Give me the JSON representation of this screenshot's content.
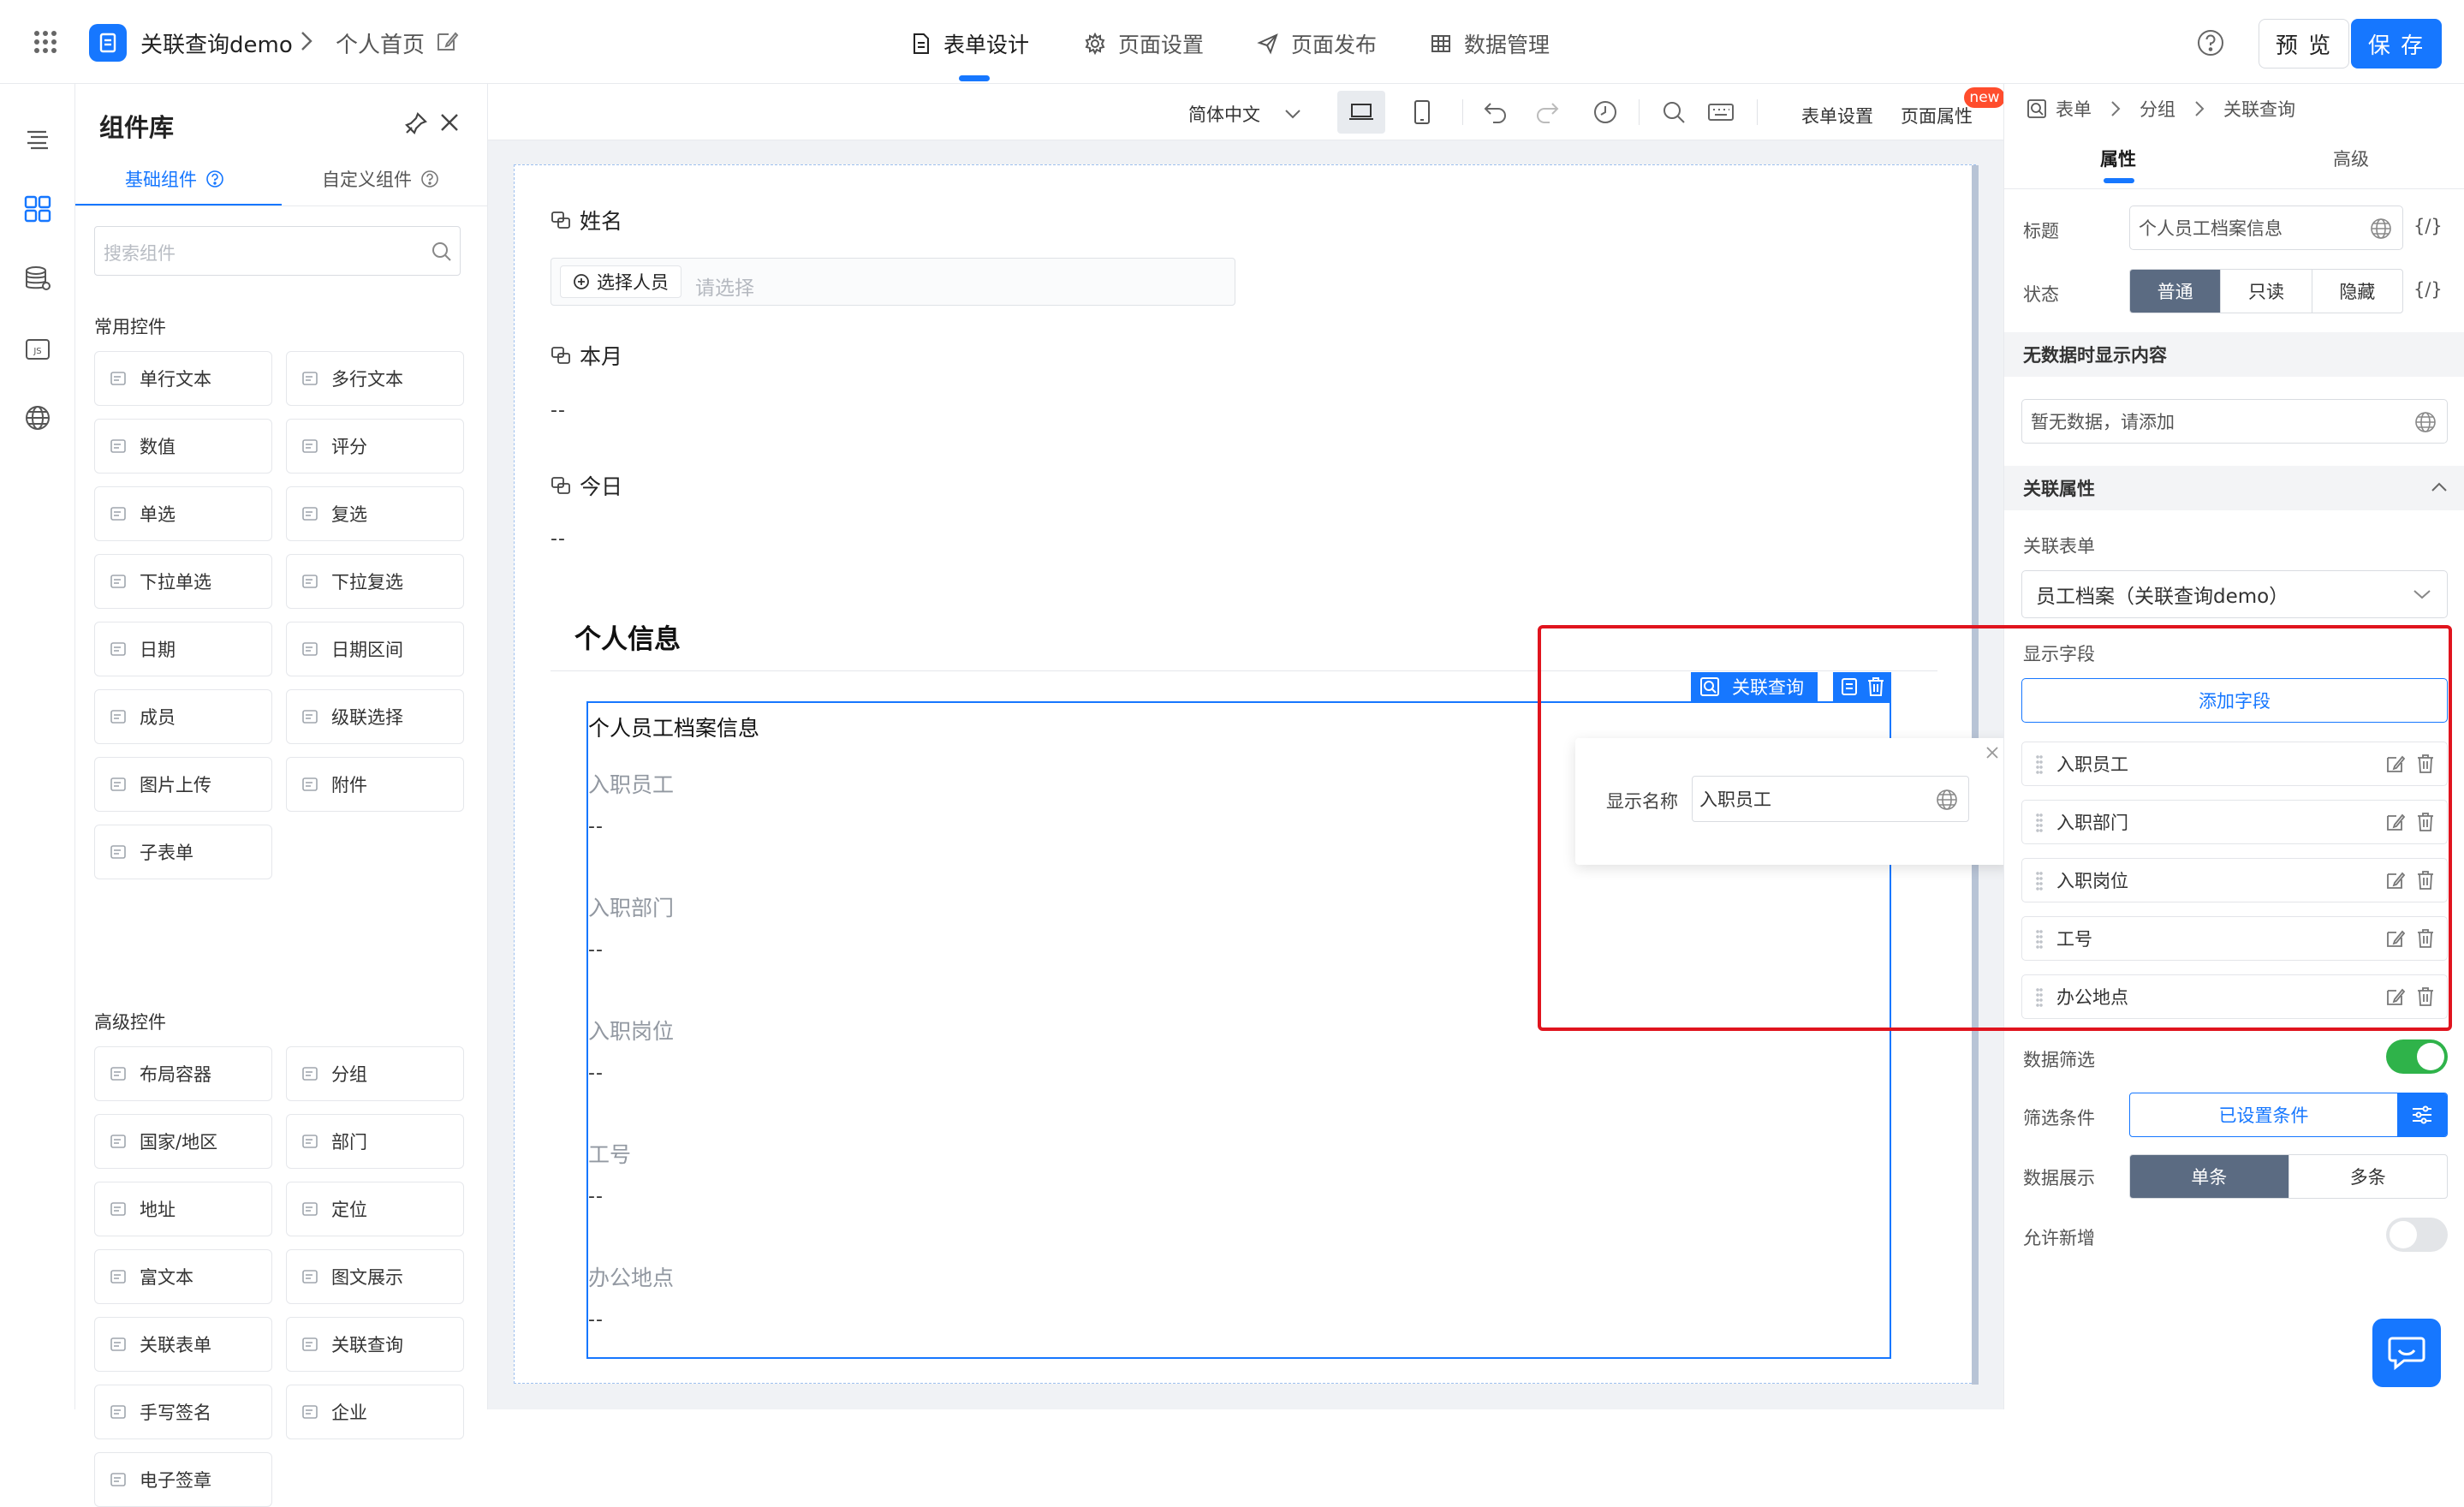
{
  "header": {
    "app_title": "关联查询demo",
    "breadcrumb_page": "个人首页",
    "tabs": [
      {
        "label": "表单设计",
        "icon": "form-icon",
        "active": true
      },
      {
        "label": "页面设置",
        "icon": "gear-icon",
        "active": false
      },
      {
        "label": "页面发布",
        "icon": "send-icon",
        "active": false
      },
      {
        "label": "数据管理",
        "icon": "table-icon",
        "active": false
      }
    ],
    "preview_label": "预 览",
    "save_label": "保 存",
    "accent_color": "#1677ff"
  },
  "rail": {
    "icons": [
      "outline-icon",
      "components-icon",
      "datasource-icon",
      "js-icon",
      "globe-icon"
    ]
  },
  "library": {
    "title": "组件库",
    "tabs": [
      "基础组件",
      "自定义组件"
    ],
    "search_placeholder": "搜索组件",
    "common_title": "常用控件",
    "common": [
      {
        "label": "单行文本",
        "icon": "single-line-icon"
      },
      {
        "label": "多行文本",
        "icon": "multi-line-icon"
      },
      {
        "label": "数值",
        "icon": "number-icon"
      },
      {
        "label": "评分",
        "icon": "star-icon"
      },
      {
        "label": "单选",
        "icon": "radio-icon"
      },
      {
        "label": "复选",
        "icon": "checkbox-icon"
      },
      {
        "label": "下拉单选",
        "icon": "dropdown-icon"
      },
      {
        "label": "下拉复选",
        "icon": "multi-dropdown-icon"
      },
      {
        "label": "日期",
        "icon": "calendar-icon"
      },
      {
        "label": "日期区间",
        "icon": "date-range-icon"
      },
      {
        "label": "成员",
        "icon": "user-icon"
      },
      {
        "label": "级联选择",
        "icon": "cascade-icon"
      },
      {
        "label": "图片上传",
        "icon": "image-icon"
      },
      {
        "label": "附件",
        "icon": "paperclip-icon"
      },
      {
        "label": "子表单",
        "icon": "subform-icon"
      }
    ],
    "advanced_title": "高级控件",
    "advanced": [
      {
        "label": "布局容器",
        "icon": "layout-icon"
      },
      {
        "label": "分组",
        "icon": "group-icon"
      },
      {
        "label": "国家/地区",
        "icon": "globe-icon"
      },
      {
        "label": "部门",
        "icon": "department-icon"
      },
      {
        "label": "地址",
        "icon": "map-icon"
      },
      {
        "label": "定位",
        "icon": "location-icon"
      },
      {
        "label": "富文本",
        "icon": "richtext-icon"
      },
      {
        "label": "图文展示",
        "icon": "image-text-icon"
      },
      {
        "label": "关联表单",
        "icon": "link-form-icon"
      },
      {
        "label": "关联查询",
        "icon": "link-query-icon"
      },
      {
        "label": "手写签名",
        "icon": "signature-icon"
      },
      {
        "label": "企业",
        "icon": "company-icon"
      },
      {
        "label": "电子签章",
        "icon": "seal-icon"
      }
    ]
  },
  "toolbar": {
    "language": "简体中文",
    "form_settings": "表单设置",
    "page_props": "页面属性",
    "new_badge": "new"
  },
  "canvas": {
    "fields": [
      {
        "label": "姓名"
      },
      {
        "label": "本月",
        "value": "--"
      },
      {
        "label": "今日",
        "value": "--"
      }
    ],
    "select_member_button": "选择人员",
    "select_placeholder": "请选择",
    "section_title": "个人信息",
    "query_tag": "关联查询",
    "query_block": {
      "title": "个人员工档案信息",
      "rows": [
        {
          "label": "入职员工",
          "value": "--"
        },
        {
          "label": "入职部门",
          "value": "--"
        },
        {
          "label": "入职岗位",
          "value": "--"
        },
        {
          "label": "工号",
          "value": "--"
        },
        {
          "label": "办公地点",
          "value": "--"
        }
      ]
    },
    "popover": {
      "label": "显示名称",
      "value": "入职员工"
    }
  },
  "props": {
    "breadcrumb": [
      "表单",
      "分组",
      "关联查询"
    ],
    "tabs": [
      "属性",
      "高级"
    ],
    "title_label": "标题",
    "title_value": "个人员工档案信息",
    "var_label": "{/}",
    "state_label": "状态",
    "state_options": [
      "普通",
      "只读",
      "隐藏"
    ],
    "empty_section": "无数据时显示内容",
    "empty_value": "暂无数据，请添加",
    "relation_section": "关联属性",
    "relation_form_label": "关联表单",
    "relation_form_value": "员工档案（关联查询demo）",
    "display_fields_label": "显示字段",
    "add_field_button": "添加字段",
    "display_fields": [
      "入职员工",
      "入职部门",
      "入职岗位",
      "工号",
      "办公地点"
    ],
    "filter_label": "数据筛选",
    "filter_enabled": true,
    "condition_label": "筛选条件",
    "condition_value": "已设置条件",
    "display_mode_label": "数据展示",
    "display_mode_options": [
      "单条",
      "多条"
    ],
    "allow_add_label": "允许新增",
    "allow_add_enabled": false,
    "toggle_on_color": "#2fb34a",
    "highlight_color": "#e0141e"
  }
}
